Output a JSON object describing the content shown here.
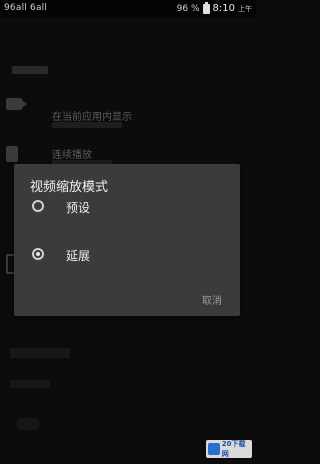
{
  "status_bar": {
    "left_text": "96all 6all",
    "battery_percent": "96 %",
    "time": "8:10",
    "ampm": "上午"
  },
  "background": {
    "row1_text": "在当前应用内显示",
    "row2_text": "连续播放"
  },
  "dialog": {
    "title": "视频缩放模式",
    "options": [
      {
        "label": "预设",
        "selected": false
      },
      {
        "label": "延展",
        "selected": true
      }
    ],
    "cancel_label": "取消"
  },
  "watermark": {
    "text": "20下载网"
  }
}
